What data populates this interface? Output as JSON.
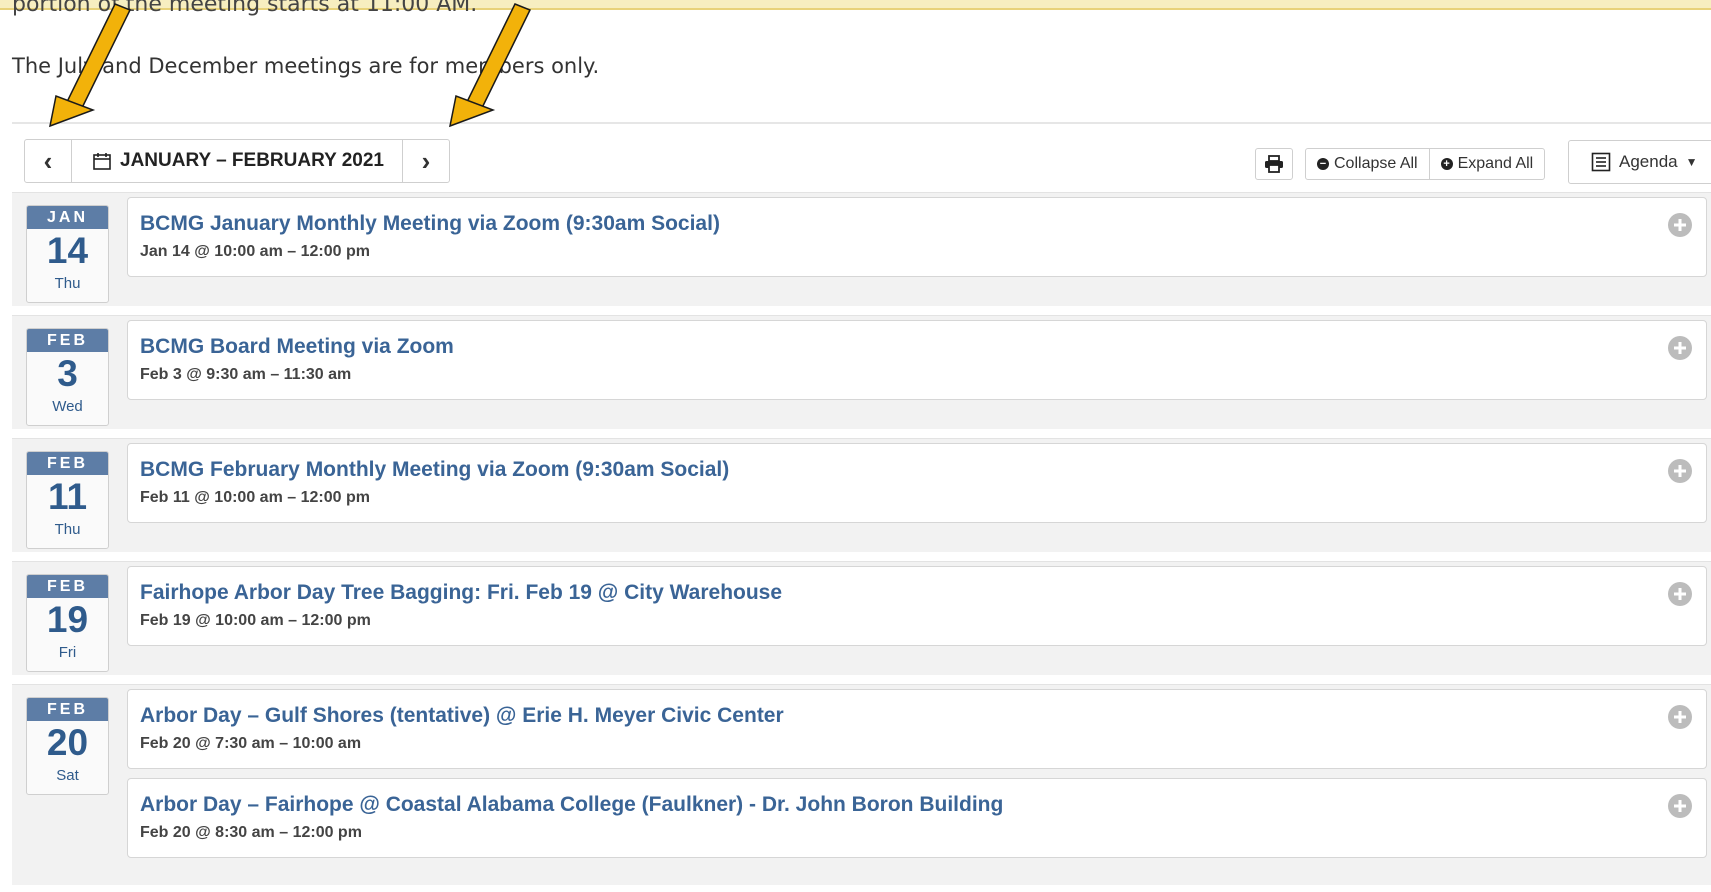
{
  "page": {
    "top_cut_text": "portion of the meeting starts at 11:00 AM.",
    "intro_text": "The July and December meetings are for members only."
  },
  "toolbar": {
    "prev_label": "‹",
    "next_label": "›",
    "date_range": "JANUARY – FEBRUARY 2021",
    "print_icon": "printer-icon",
    "collapse_label": "Collapse All",
    "expand_label": "Expand All",
    "view_label": "Agenda",
    "view_icon": "list-icon"
  },
  "colors": {
    "badge_month_bg": "#5d7da6",
    "event_title": "#3a6496",
    "annotation_arrow": "#f2b20a"
  },
  "days": [
    {
      "month": "JAN",
      "day": "14",
      "weekday": "Thu",
      "events": [
        {
          "title": "BCMG January Monthly Meeting via Zoom (9:30am Social)",
          "time": "Jan 14 @ 10:00 am – 12:00 pm"
        }
      ]
    },
    {
      "month": "FEB",
      "day": "3",
      "weekday": "Wed",
      "events": [
        {
          "title": "BCMG Board Meeting via Zoom",
          "time": "Feb 3 @ 9:30 am – 11:30 am"
        }
      ]
    },
    {
      "month": "FEB",
      "day": "11",
      "weekday": "Thu",
      "events": [
        {
          "title": "BCMG February Monthly Meeting via Zoom (9:30am Social)",
          "time": "Feb 11 @ 10:00 am – 12:00 pm"
        }
      ]
    },
    {
      "month": "FEB",
      "day": "19",
      "weekday": "Fri",
      "events": [
        {
          "title": "Fairhope Arbor Day Tree Bagging: Fri. Feb 19 @ City Warehouse",
          "time": "Feb 19 @ 10:00 am – 12:00 pm"
        }
      ]
    },
    {
      "month": "FEB",
      "day": "20",
      "weekday": "Sat",
      "events": [
        {
          "title": "Arbor Day – Gulf Shores (tentative) @ Erie H. Meyer Civic Center",
          "time": "Feb 20 @ 7:30 am – 10:00 am"
        },
        {
          "title": "Arbor Day – Fairhope @ Coastal Alabama College (Faulkner) - Dr. John Boron Building",
          "time": "Feb 20 @ 8:30 am – 12:00 pm"
        }
      ]
    }
  ]
}
